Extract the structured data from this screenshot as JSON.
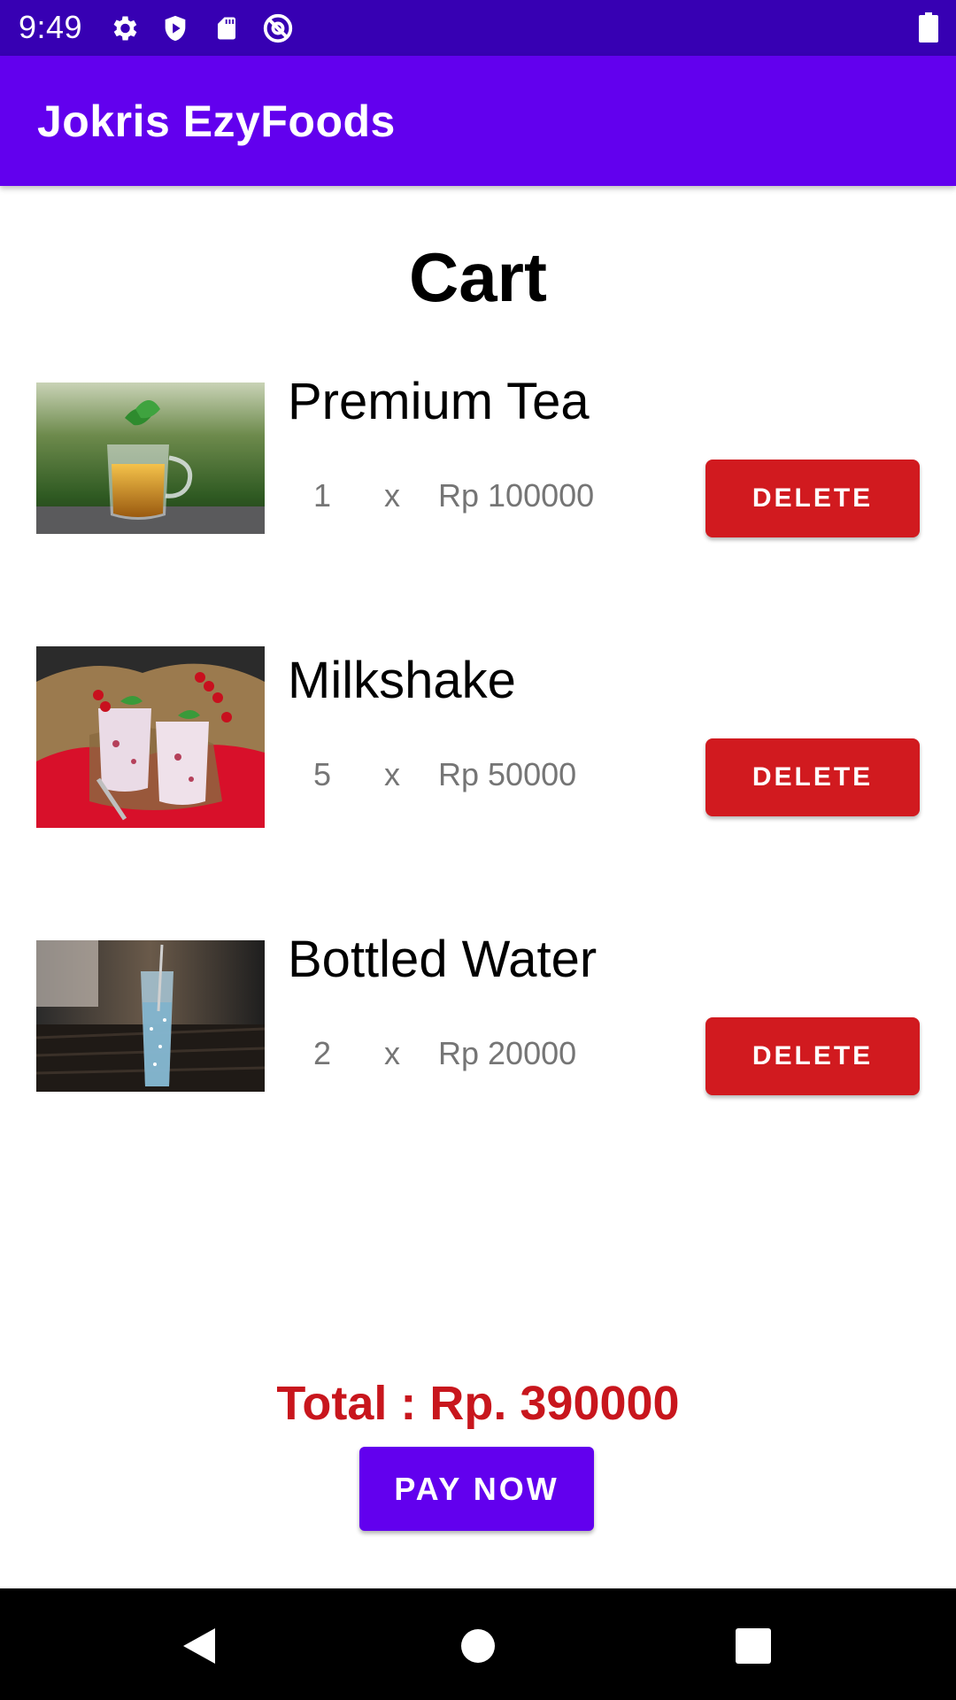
{
  "status_bar": {
    "time": "9:49",
    "icons": [
      "gear-icon",
      "shield-play-icon",
      "sd-card-icon",
      "at-sign-icon"
    ],
    "battery_icon": "battery-icon",
    "color": "#3700b3"
  },
  "app_bar": {
    "title": "Jokris EzyFoods",
    "color": "#6200ee"
  },
  "page": {
    "title": "Cart"
  },
  "cart": {
    "items": [
      {
        "name": "Premium Tea",
        "qty": "1",
        "times": "x",
        "price": "Rp 100000",
        "delete_label": "DELETE",
        "image": "tea-cup-photo"
      },
      {
        "name": "Milkshake",
        "qty": "5",
        "times": "x",
        "price": "Rp 50000",
        "delete_label": "DELETE",
        "image": "milkshake-photo"
      },
      {
        "name": "Bottled Water",
        "qty": "2",
        "times": "x",
        "price": "Rp 20000",
        "delete_label": "DELETE",
        "image": "water-glass-photo"
      }
    ]
  },
  "summary": {
    "total": "Total : Rp. 390000",
    "pay_label": "PAY NOW",
    "total_color": "#c8161d",
    "delete_color": "#d11a1f"
  },
  "nav_bar": {
    "icons": [
      "back-icon",
      "home-icon",
      "recents-icon"
    ]
  }
}
